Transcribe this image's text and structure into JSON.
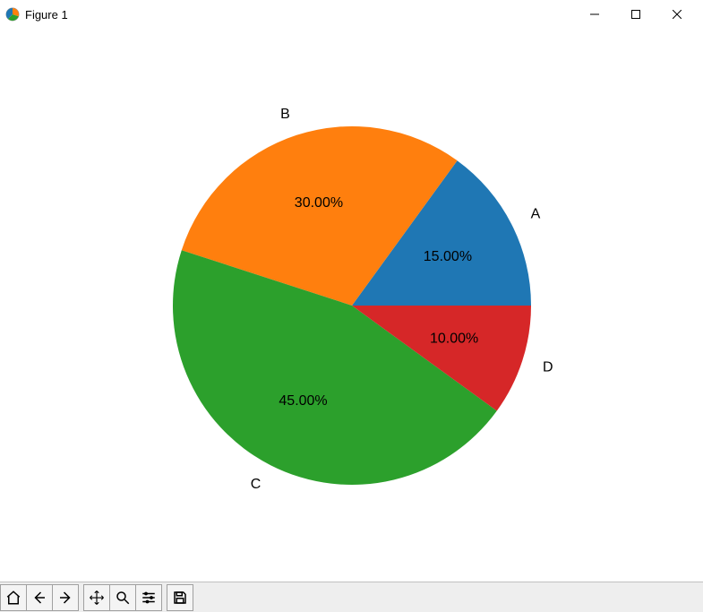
{
  "window": {
    "title": "Figure 1"
  },
  "chart_data": {
    "type": "pie",
    "categories": [
      "A",
      "B",
      "C",
      "D"
    ],
    "values": [
      15,
      30,
      45,
      10
    ],
    "colors": [
      "#1f77b4",
      "#ff7f0e",
      "#2ca02c",
      "#d62728"
    ],
    "pct_labels": [
      "15.00%",
      "30.00%",
      "45.00%",
      "10.00%"
    ],
    "title": ""
  },
  "toolbar": {
    "home": "Home",
    "back": "Back",
    "forward": "Forward",
    "pan": "Pan",
    "zoom": "Zoom",
    "configure": "Configure subplots",
    "save": "Save"
  }
}
